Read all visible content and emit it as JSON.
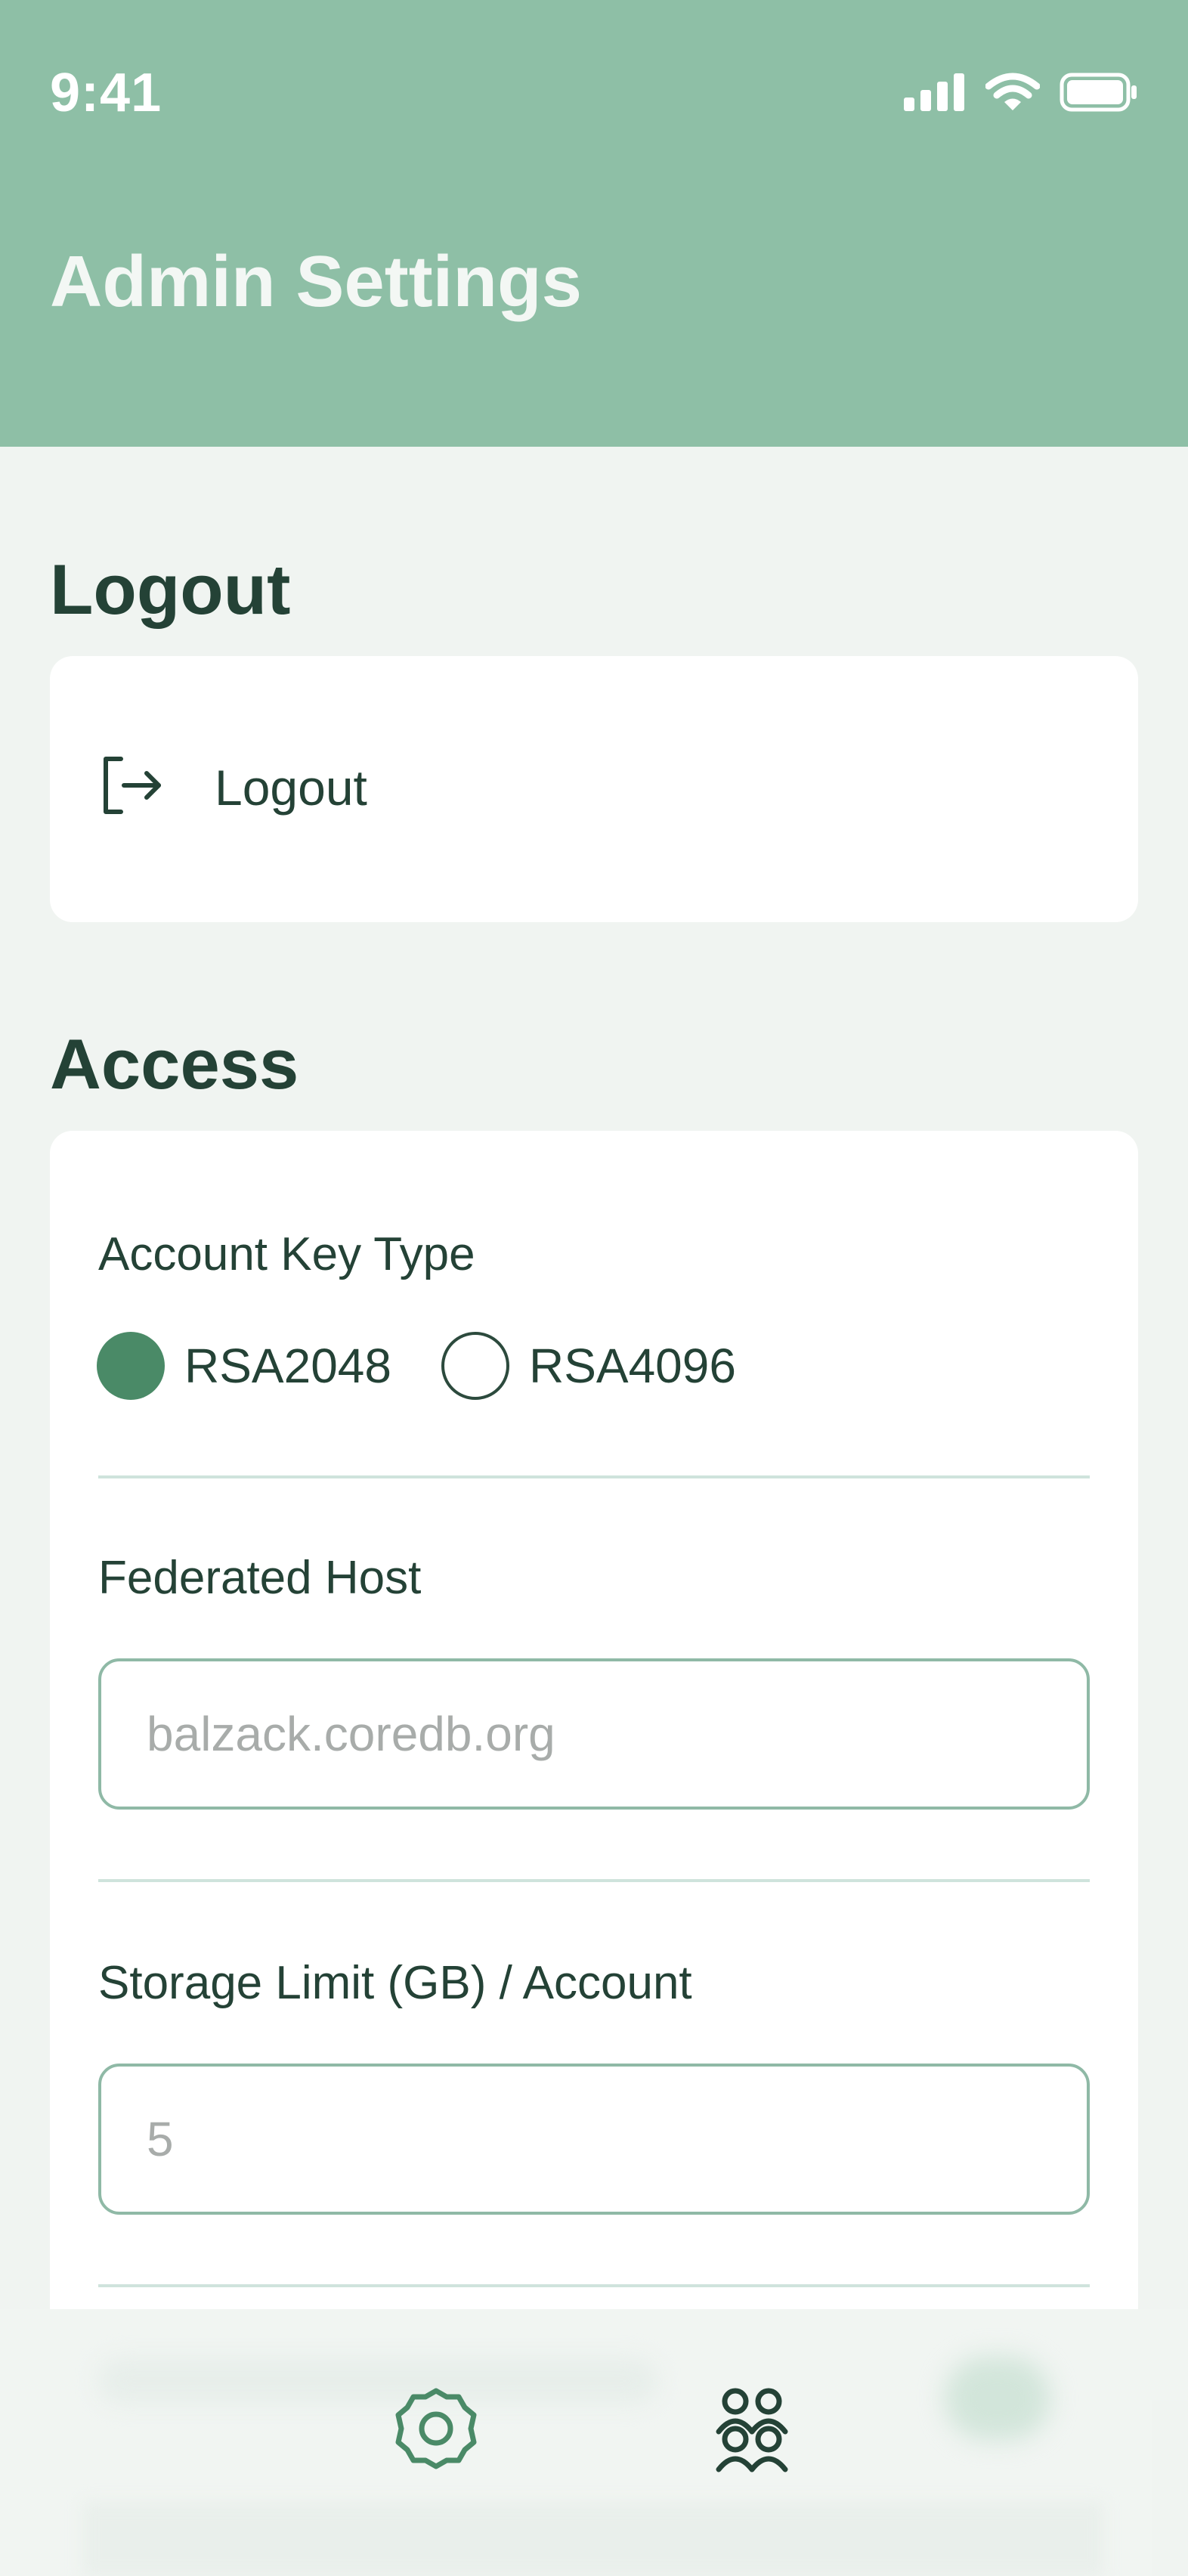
{
  "status_bar": {
    "time": "9:41"
  },
  "header": {
    "title": "Admin Settings"
  },
  "logout_section": {
    "title": "Logout",
    "item_label": "Logout",
    "icon": "logout-icon"
  },
  "access_section": {
    "title": "Access",
    "account_key_type": {
      "label": "Account Key Type",
      "options": [
        "RSA2048",
        "RSA4096"
      ],
      "selected": "RSA2048"
    },
    "federated_host": {
      "label": "Federated Host",
      "placeholder": "balzack.coredb.org",
      "value": ""
    },
    "storage_limit": {
      "label": "Storage Limit (GB) / Account",
      "placeholder": "5",
      "value": ""
    }
  },
  "tab_bar": {
    "tabs": [
      {
        "name": "settings",
        "icon": "gear-icon",
        "active": true
      },
      {
        "name": "accounts",
        "icon": "users-icon",
        "active": false
      }
    ]
  },
  "colors": {
    "header_bg": "#8ebfa6",
    "page_bg": "#f0f4f1",
    "accent": "#4a8a67",
    "text_dark": "#244236"
  }
}
